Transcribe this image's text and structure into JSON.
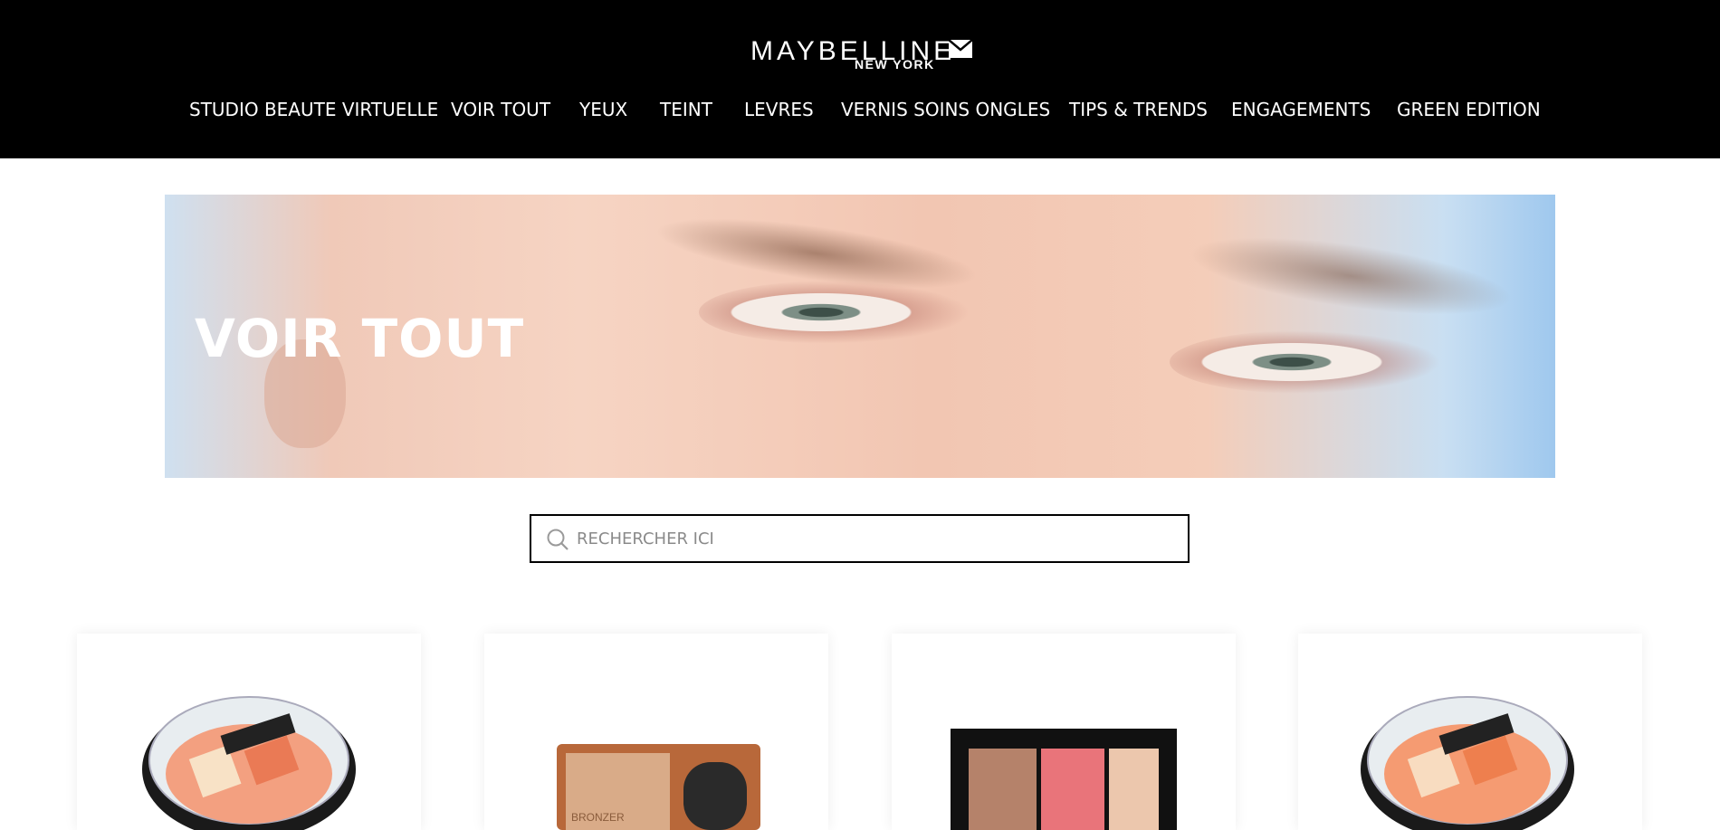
{
  "header": {
    "logo_main": "MAYBELLINE",
    "logo_sub": "NEW YORK",
    "nav": [
      {
        "label": "STUDIO BEAUTE VIRTUELLE"
      },
      {
        "label": "VOIR TOUT"
      },
      {
        "label": "YEUX"
      },
      {
        "label": "TEINT"
      },
      {
        "label": "LEVRES"
      },
      {
        "label": "VERNIS SOINS ONGLES"
      },
      {
        "label": "TIPS & TRENDS"
      },
      {
        "label": "ENGAGEMENTS"
      },
      {
        "label": "GREEN EDITION"
      }
    ]
  },
  "hero": {
    "title": "VOIR TOUT"
  },
  "search": {
    "placeholder": "RECHERCHER ICI"
  },
  "products": [
    {
      "image": "master-strobing-highlighter-compact"
    },
    {
      "image": "bronzer-compact-with-brush"
    },
    {
      "image": "contour-blush-highlight-palette"
    },
    {
      "image": "master-strobing-highlighter-compact"
    }
  ],
  "colors": {
    "header_bg": "#000000",
    "accent": "#ffffff"
  }
}
